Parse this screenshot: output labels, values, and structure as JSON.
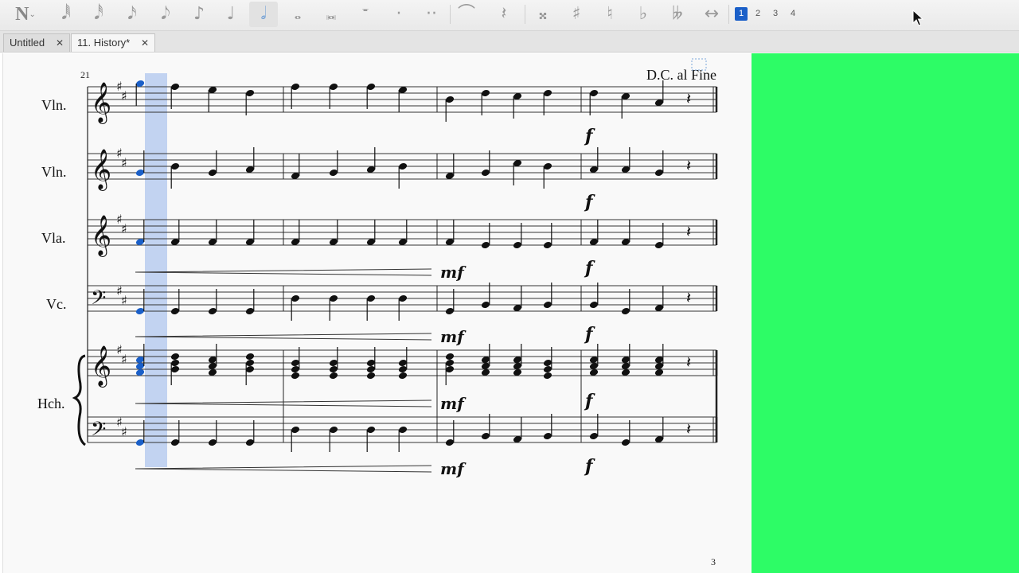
{
  "toolbar": {
    "note_input_glyph": "𝄽",
    "durations": [
      "𝅘𝅥𝅱",
      "𝅘𝅥𝅰",
      "𝅘𝅥𝅯",
      "𝅘𝅥𝅮",
      "♪",
      "♩",
      "𝅗𝅥",
      "𝅝",
      "𝅜",
      "𝄻",
      "·",
      "··"
    ],
    "tools": [
      "⌒",
      "𝄽",
      "𝄪",
      "♯",
      "♮",
      "♭",
      "𝄫",
      "↔"
    ],
    "voices": [
      "1",
      "2",
      "3",
      "4"
    ],
    "active_voice": "1"
  },
  "tabs": [
    {
      "label": "Untitled",
      "close": "✕"
    },
    {
      "label": "11. History*",
      "close": "✕"
    }
  ],
  "score": {
    "measure_number": "21",
    "tempo_text": "D.C. al Fine",
    "page_number": "3",
    "instruments": [
      "Vln.",
      "Vln.",
      "Vla.",
      "Vc.",
      "Hch."
    ],
    "dynamics": {
      "mf": "mf",
      "f": "f"
    }
  },
  "colors": {
    "selection": "#b8cdf0",
    "green_panel": "#2dfc66",
    "note": "#111111",
    "selected_note": "#1a5fc8"
  }
}
